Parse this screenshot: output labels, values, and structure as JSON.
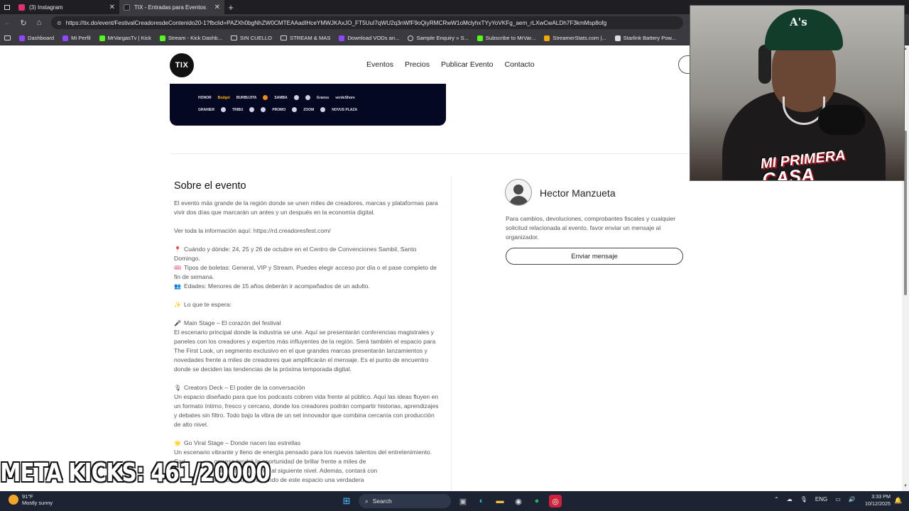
{
  "browser": {
    "tabs": [
      {
        "title": "(3) Instagram",
        "active": false,
        "favicon_color": "#e1306c"
      },
      {
        "title": "TIX - Entradas para Eventos",
        "active": true,
        "favicon_color": "#222222"
      }
    ],
    "url": "https://tix.do/event/FestivalCreadoresdeContenido20-1?fbclid=PAZXh0bgNhZW0CMTEAAadIHceYMWJKAxJO_FT5UuI7qWU2q3nWfF9oQiyRMCRwW1oMclyhxTYyYoVKFg_aem_rLXwCwALDh7F3kmMsp8ofg",
    "bookmarks": [
      {
        "label": "Dashboard",
        "icon": "twitch-icon",
        "color": "#9146ff"
      },
      {
        "label": "Mi Perfil",
        "icon": "twitch-icon",
        "color": "#9146ff"
      },
      {
        "label": "MrVargasTv | Kick",
        "icon": "kick-icon",
        "color": "#53fc18"
      },
      {
        "label": "Stream - Kick Dashb...",
        "icon": "kick-icon",
        "color": "#53fc18"
      },
      {
        "label": "SIN CUELLO",
        "icon": "folder-icon",
        "color": ""
      },
      {
        "label": "STREAM & MAS",
        "icon": "folder-icon",
        "color": ""
      },
      {
        "label": "Download VODs an...",
        "icon": "twitch-icon",
        "color": "#9146ff"
      },
      {
        "label": "Sample Enquiry » S...",
        "icon": "globe-icon",
        "color": ""
      },
      {
        "label": "Subscribe to MrVar...",
        "icon": "kick-icon",
        "color": "#53fc18"
      },
      {
        "label": "StreamerStats.com |...",
        "icon": "chart-icon",
        "color": "#f2a900"
      },
      {
        "label": "Starlink Battery Pow...",
        "icon": "page-icon",
        "color": "#dddddd"
      }
    ]
  },
  "site": {
    "logo": "TIX",
    "nav": [
      "Eventos",
      "Precios",
      "Publicar Evento",
      "Contacto"
    ]
  },
  "banner": {
    "sponsors_row1": [
      "HONOR",
      "Budget",
      "BURBUJITA",
      "SAMBA",
      "Granos",
      "verdeShore"
    ],
    "sponsors_row2": [
      "GRANIER",
      "TRIBU",
      "PROMO",
      "ZOOM",
      "NOVUS PLAZA"
    ]
  },
  "about": {
    "heading": "Sobre el evento",
    "intro_1": "El evento más grande de la región donde se unen miles de creadores, marcas y plataformas para",
    "intro_2": "vivir dos días que marcarán un antes y un después en la economía digital.",
    "info_link": "Ver toda la información aquí: https://rd.creadoresfest.com/",
    "when_1": "Cuándo y dónde: 24, 25 y 26 de octubre en el Centro de Convenciones Sambil, Santo",
    "when_2": "Domingo.",
    "tickets_1": "Tipos de boletas: General, VIP y Stream. Puedes elegir acceso por día o el pase completo de",
    "tickets_2": "fin de semana.",
    "ages": "Edades: Menores de 15 años deberán ir acompañados de un adulto.",
    "expect": "Lo que te espera:",
    "main_stage_title": "Main Stage – El corazón del festival",
    "main_stage_1": "El escenario principal donde la industria se une. Aquí se presentarán conferencias magistrales y",
    "main_stage_2": "paneles con los creadores y expertos más influyentes de la región. Será también el espacio para",
    "main_stage_3": "The First Look, un segmento exclusivo en el que grandes marcas presentarán lanzamientos y",
    "main_stage_4": "novedades frente a miles de creadores que amplificarán el mensaje. Es el punto de encuentro",
    "main_stage_5": "donde se deciden las tendencias de la próxima temporada digital.",
    "creators_title": "Creators Deck – El poder de la conversación",
    "creators_1": "Un espacio diseñado para que los podcasts cobren vida frente al público. Aquí las ideas fluyen en",
    "creators_2": "un formato íntimo, fresco y cercano, donde los creadores podrán compartir historias, aprendizajes",
    "creators_3": "y debates sin filtro. Todo bajo la vibra de un set innovador que combina cercanía con producción",
    "creators_4": "de alto nivel.",
    "viral_title": "Go Viral Stage – Donde nacen las estrellas",
    "viral_1": "Un escenario vibrante y lleno de energía pensado para los nuevos talentos del entretenimiento.",
    "viral_2": "Cad                 orpresa tendrá la oportunidad de brillar frente a miles de",
    "viral_3": "                   en catapultar su talento al siguiente nivel. Además, contará con",
    "viral_4": "                  stas reconocidos, haciendo de este espacio una verdadera"
  },
  "organizer": {
    "name": "Hector Manzueta",
    "desc_1": "Para cambios, devoluciones, comprobantes fiscales y cualquier",
    "desc_2": "solicitud relacionada al evento, favor enviar un mensaje al",
    "desc_3": "organizador.",
    "button": "Enviar mensaje"
  },
  "overlay": {
    "cap_logo": "A's",
    "brand_1": "MI PRIMERA",
    "brand_2": "CASA",
    "meta_kicks": "META KICKS: 461/20000"
  },
  "taskbar": {
    "temp": "91°F",
    "weather": "Mostly sunny",
    "search": "Search",
    "lang": "ENG",
    "time": "3:33 PM",
    "date": "10/12/2025"
  }
}
